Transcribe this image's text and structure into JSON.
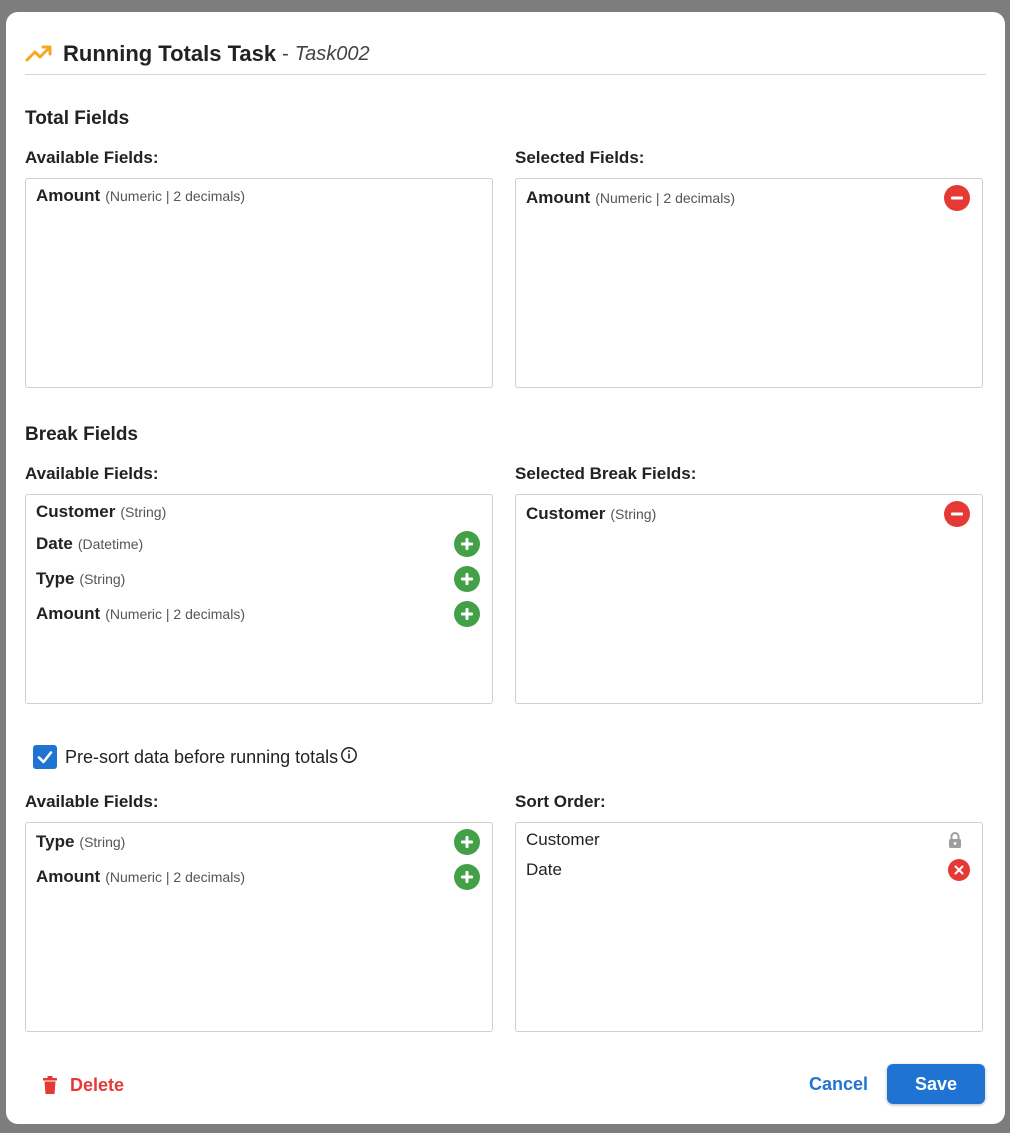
{
  "dialog": {
    "title": "Running Totals Task",
    "separator": "-",
    "task_name": "Task002"
  },
  "total_fields": {
    "heading": "Total Fields",
    "available_label": "Available Fields:",
    "selected_label": "Selected Fields:",
    "available": [
      {
        "name": "Amount",
        "type": "(Numeric | 2 decimals)"
      }
    ],
    "selected": [
      {
        "name": "Amount",
        "type": "(Numeric | 2 decimals)"
      }
    ]
  },
  "break_fields": {
    "heading": "Break Fields",
    "available_label": "Available Fields:",
    "selected_label": "Selected Break Fields:",
    "available": [
      {
        "name": "Customer",
        "type": "(String)"
      },
      {
        "name": "Date",
        "type": "(Datetime)"
      },
      {
        "name": "Type",
        "type": "(String)"
      },
      {
        "name": "Amount",
        "type": "(Numeric | 2 decimals)"
      }
    ],
    "selected": [
      {
        "name": "Customer",
        "type": "(String)"
      }
    ]
  },
  "presort": {
    "label": "Pre-sort data before running totals",
    "checked": true
  },
  "sort": {
    "available_label": "Available Fields:",
    "order_label": "Sort Order:",
    "available": [
      {
        "name": "Type",
        "type": "(String)"
      },
      {
        "name": "Amount",
        "type": "(Numeric | 2 decimals)"
      }
    ],
    "order": [
      {
        "name": "Customer"
      },
      {
        "name": "Date"
      }
    ]
  },
  "footer": {
    "delete_label": "Delete",
    "cancel_label": "Cancel",
    "save_label": "Save"
  },
  "colors": {
    "accent": "#1f74d3",
    "add": "#43a047",
    "remove": "#e53935",
    "title_icon": "#f5a623"
  }
}
